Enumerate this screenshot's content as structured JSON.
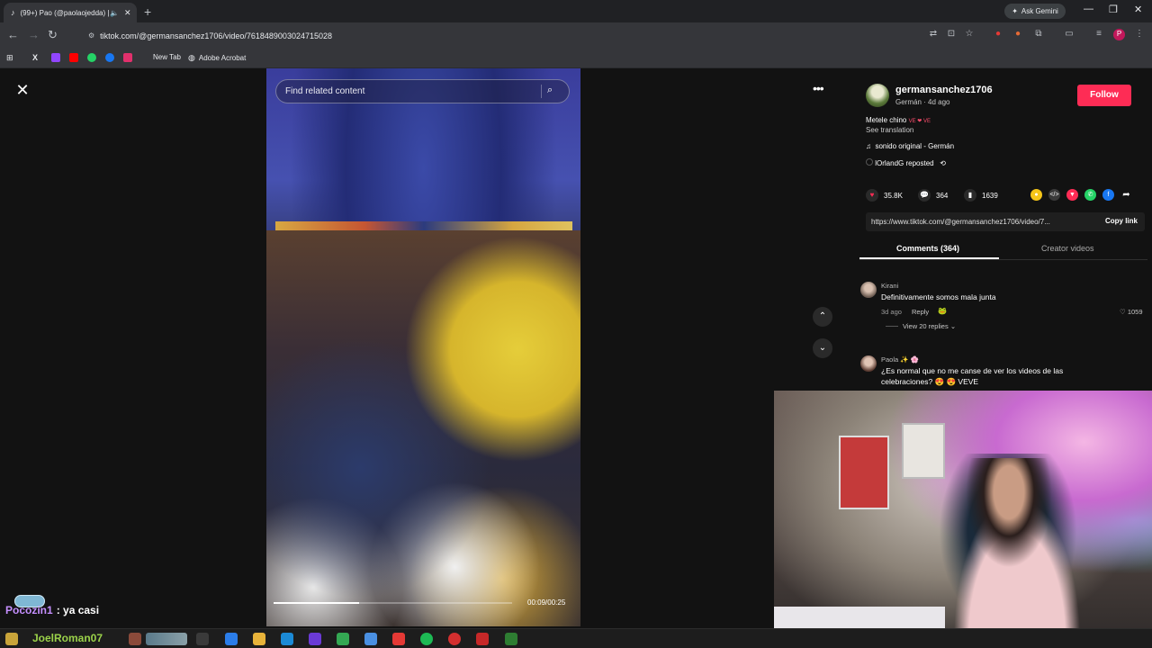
{
  "browser": {
    "tab_title": "(99+) Pao (@paolaojedda) |",
    "new_tab_symbol": "+",
    "ask_gemini": "Ask Gemini",
    "url": "tiktok.com/@germansanchez1706/video/7618489003024715028",
    "bookmarks": [
      "New Tab",
      "Adobe Acrobat"
    ]
  },
  "video": {
    "search_placeholder": "Find related content",
    "timecode": "00:09/00:25",
    "progress_fraction": 0.36
  },
  "post": {
    "author": "germansanchez1706",
    "author_sub": "Germán · 4d ago",
    "follow": "Follow",
    "caption": "Metele chino ",
    "caption_flags": "VE ❤ VE",
    "see_translation": "See translation",
    "sound": "sonido original - Germán",
    "repost": "lOrlandG reposted",
    "likes": "35.8K",
    "comments": "364",
    "saves": "1639",
    "link": "https://www.tiktok.com/@germansanchez1706/video/7...",
    "copy_link": "Copy link",
    "tab_comments": "Comments (364)",
    "tab_creator": "Creator videos"
  },
  "comments": [
    {
      "name": "Kirani",
      "text": "Definitivamente somos mala junta",
      "date": "3d ago",
      "reply": "Reply",
      "likes": "1059",
      "view_replies": "View 20 replies"
    },
    {
      "name": "Paola ✨ 🌸",
      "text_line1": "¿Es normal que no me canse de ver los videos de las",
      "text_line2": "celebraciones? 😍 😍 VEVE"
    }
  ],
  "chat": {
    "user": "Pocozin1",
    "message": ": ya casi",
    "taskbar_user": "JoelRoman07"
  },
  "colors": {
    "accent": "#fe2c55",
    "chat_user": "#c58fff",
    "taskbar_user": "#9bd24a"
  }
}
